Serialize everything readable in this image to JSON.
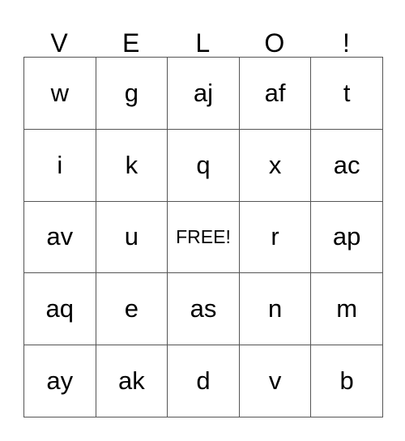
{
  "card": {
    "type": "bingo-card",
    "header_letters": [
      "V",
      "E",
      "L",
      "O",
      "!"
    ],
    "rows": [
      [
        "w",
        "g",
        "aj",
        "af",
        "t"
      ],
      [
        "i",
        "k",
        "q",
        "x",
        "ac"
      ],
      [
        "av",
        "u",
        "FREE!",
        "r",
        "ap"
      ],
      [
        "aq",
        "e",
        "as",
        "n",
        "m"
      ],
      [
        "ay",
        "ak",
        "d",
        "v",
        "b"
      ]
    ],
    "free_cell": {
      "row": 2,
      "column": 2,
      "label": "FREE!"
    },
    "colors": {
      "background": "#ffffff",
      "text": "#000000",
      "grid_line": "#555555"
    }
  }
}
